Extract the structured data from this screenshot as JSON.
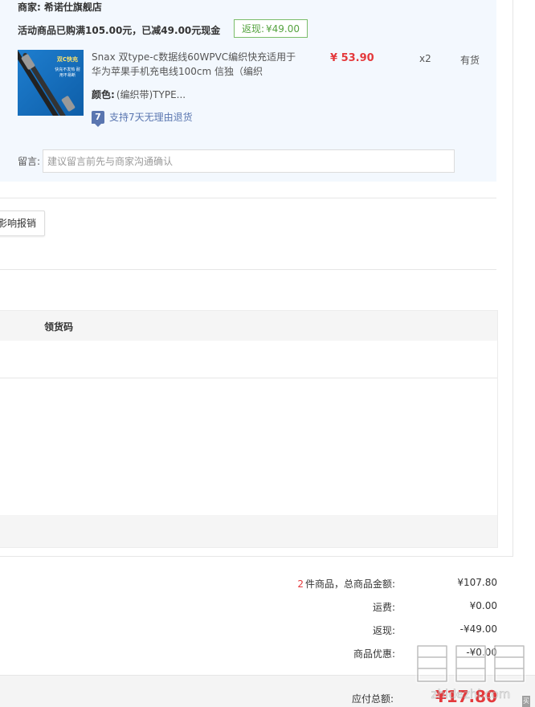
{
  "merchant": {
    "label": "商家:",
    "name": "希诺仕旗舰店",
    "promo_text": "活动商品已购满105.00元，已减49.00元现金",
    "cashback_label": "返现:",
    "cashback_value": "¥49.00"
  },
  "product": {
    "thumb_tag": "双C快充",
    "thumb_sub": "快充不发热 耐用不易断",
    "title": "Snax 双type-c数据线60WPVC编织快充适用于华为苹果手机充电线100cm 信独（编织",
    "price": "¥ 53.90",
    "qty": "x2",
    "stock": "有货",
    "color_label": "颜色:",
    "color_value": "(编织带)TYPE...",
    "return_badge": "7",
    "return_text": "支持7天无理由退货"
  },
  "note": {
    "label": "留言:",
    "placeholder": "建议留言前先与商家沟通确认"
  },
  "invoice": {
    "button_label": "影响报销"
  },
  "pickup": {
    "column_header": "领货码"
  },
  "summary": {
    "item_count": "2",
    "items_label": "件商品，总商品金额:",
    "items_total": "¥107.80",
    "shipping_label": "运费:",
    "shipping_value": "¥0.00",
    "cashback_label": "返现:",
    "cashback_value": "-¥49.00",
    "discount_label": "商品优惠:",
    "discount_value": "-¥0.00",
    "payable_label": "应付总额:",
    "payable_value": "¥17.80"
  },
  "watermark": {
    "text": "值 什么值得买",
    "url": "zhidezhi.com"
  },
  "colors": {
    "accent_red": "#e4393c",
    "panel_bg": "#f3f8fe",
    "cashback_green": "#55a33f",
    "link_blue": "#5a76b0"
  },
  "icons": {
    "return_policy": "seven-day-return-icon",
    "product_image": "usb-c-cable-product-image"
  }
}
